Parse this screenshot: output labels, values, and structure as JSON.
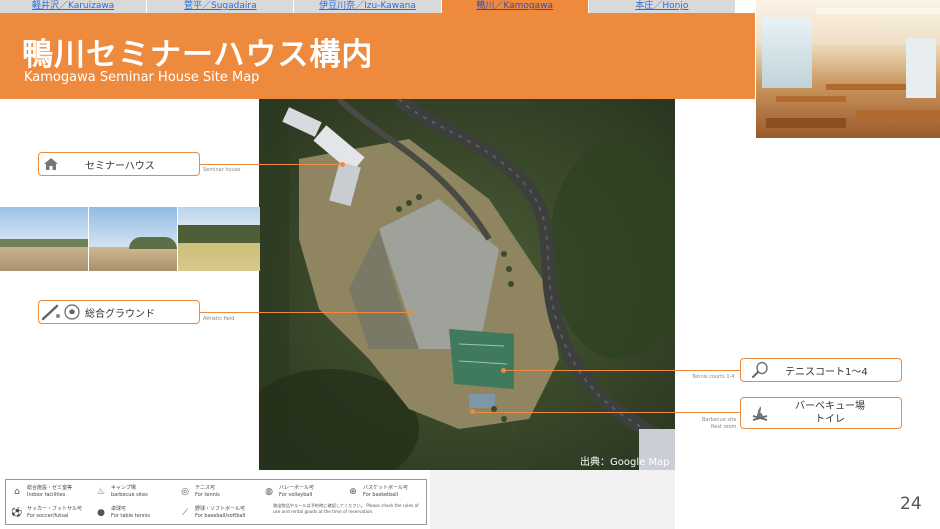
{
  "nav": [
    {
      "label": "軽井沢／Karuizawa",
      "active": false
    },
    {
      "label": "菅平／Sugadaira",
      "active": false
    },
    {
      "label": "伊豆川奈／Izu-Kawana",
      "active": false
    },
    {
      "label": "鴨川／Kamogawa",
      "active": true
    },
    {
      "label": "本庄／Honjo",
      "active": false
    }
  ],
  "header": {
    "title": "鴨川セミナーハウス構内",
    "subtitle": "Kamogawa Seminar House Site Map"
  },
  "map": {
    "credit": "出典：Google Map"
  },
  "labels": {
    "seminar": {
      "ja": "セミナーハウス",
      "en": "Seminar house",
      "icon": "house-icon"
    },
    "athletic": {
      "ja": "総合グラウンド",
      "en": "Athletic field",
      "icon": "bat-ball-icon"
    },
    "tennis": {
      "ja": "テニスコート1～4",
      "en": "Tennis courts 1-4",
      "icon": "tennis-racket-icon"
    },
    "bbq": {
      "ja1": "バーベキュー場",
      "ja2": "トイレ",
      "en1": "Barbecue site",
      "en2": "Rest room",
      "icon": "campfire-icon"
    }
  },
  "legend": {
    "items": [
      {
        "ja": "総合施設・ゼミ室等",
        "en": "Indoor facilities",
        "icon": "house-icon"
      },
      {
        "ja": "キャンプ場",
        "en": "barbecue sites",
        "icon": "campfire-icon"
      },
      {
        "ja": "テニス可",
        "en": "For tennis",
        "icon": "tennis-racket-icon"
      },
      {
        "ja": "バレーボール可",
        "en": "For volleyball",
        "icon": "volleyball-icon"
      },
      {
        "ja": "バスケットボール可",
        "en": "For basketball",
        "icon": "basketball-icon"
      },
      {
        "ja": "サッカー・フットサル可",
        "en": "For soccer/futsal",
        "icon": "soccer-ball-icon"
      },
      {
        "ja": "卓球可",
        "en": "For table tennis",
        "icon": "ping-pong-icon"
      },
      {
        "ja": "野球・ソフトボール可",
        "en": "For baseball/softball",
        "icon": "bat-icon"
      }
    ],
    "note": "貸出物品やルールは予約時に確認してください。 Please check the rules of use and rental goods at the time of reservation."
  },
  "page_number": "24",
  "colors": {
    "accent": "#ee8a3d",
    "nav_bg": "#d9d9d9",
    "link": "#2f6bd8"
  }
}
